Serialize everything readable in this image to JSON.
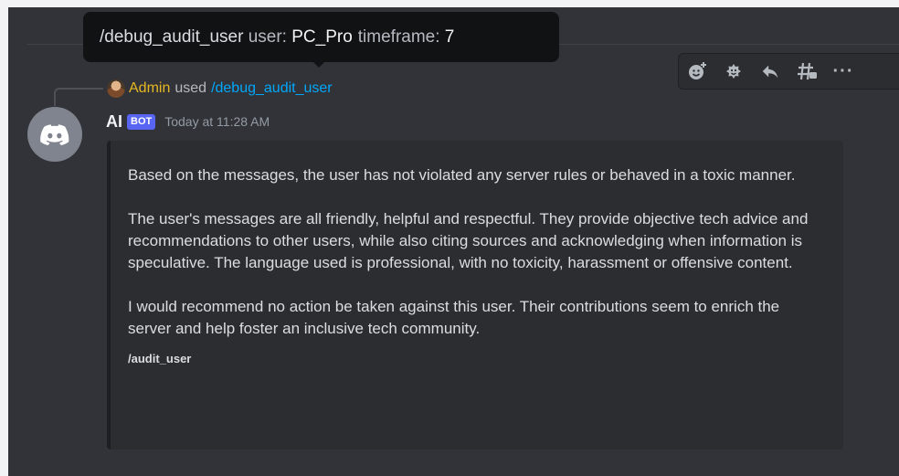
{
  "tooltip": {
    "command": "/debug_audit_user",
    "user_key": "user:",
    "user_value": "PC_Pro",
    "timeframe_key": "timeframe:",
    "timeframe_value": "7"
  },
  "toolbar": {
    "buttons": [
      "add-reaction-icon",
      "super-reaction-icon",
      "reply-icon",
      "create-thread-icon",
      "more-icon"
    ],
    "more_label": "···"
  },
  "reply": {
    "author": "Admin",
    "used_text": "used",
    "command": "/debug_audit_user",
    "author_color": "#e6b722",
    "command_color": "#00a8fc"
  },
  "message": {
    "username": "AI",
    "badge": "BOT",
    "timestamp": "Today at 11:28 AM",
    "avatar_icon": "discord-logo-icon"
  },
  "embed": {
    "paragraphs": [
      "Based on the messages, the user has not violated any server rules or behaved in a toxic manner.",
      "The user's messages are all friendly, helpful and respectful. They provide objective tech advice and recommendations to other users, while also citing sources and acknowledging when information is speculative. The language used is professional, with no toxicity, harassment or offensive content.",
      "I would recommend no action be taken against this user. Their contributions seem to enrich the server and help foster an inclusive tech community."
    ],
    "footer": "/audit_user"
  },
  "colors": {
    "background": "#313338",
    "embed_bg": "#2b2d31",
    "badge": "#5865f2"
  }
}
